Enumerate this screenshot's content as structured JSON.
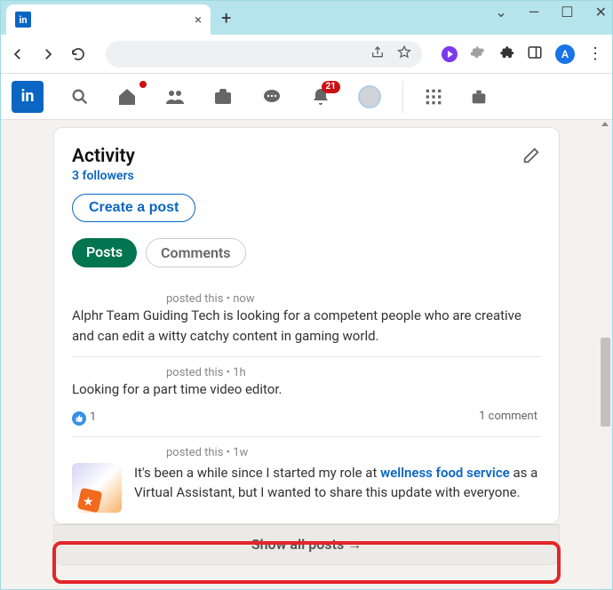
{
  "window": {
    "favicon_text": "in",
    "close_glyph": "×",
    "new_tab_glyph": "+",
    "controls": {
      "chevron": "⌄",
      "min": "—",
      "max": "☐",
      "close": "✕"
    }
  },
  "browser": {
    "avatar_letter": "A",
    "menu_glyph": "⋮"
  },
  "linkedin_nav": {
    "logo_text": "in",
    "home_badge": "",
    "notifications_badge": "21"
  },
  "activity": {
    "title": "Activity",
    "followers": "3 followers",
    "create_post": "Create a post",
    "tabs": {
      "posts": "Posts",
      "comments": "Comments"
    }
  },
  "posts": [
    {
      "meta": "posted this • now",
      "body": "Alphr Team Guiding Tech is looking for a competent people who are creative and can edit a witty catchy content in gaming world."
    },
    {
      "meta": "posted this • 1h",
      "body": "Looking for a part time video editor.",
      "likes": "1",
      "comments": "1 comment"
    },
    {
      "meta": "posted this • 1w",
      "body_prefix": "It's been a while since I started my role at ",
      "body_link": "wellness food service",
      "body_suffix": " as a Virtual Assistant, but I wanted to share this update with everyone."
    }
  ],
  "show_all": "Show all posts →"
}
